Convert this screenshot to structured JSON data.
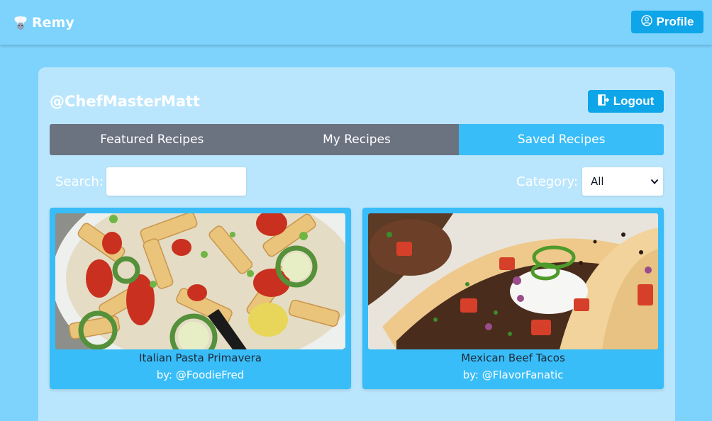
{
  "navbar": {
    "brand": "Remy",
    "brand_icon": "chef-hat-icon",
    "profile_label": "Profile",
    "profile_icon": "user-circle-icon"
  },
  "account": {
    "username": "@ChefMasterMatt",
    "logout_label": "Logout",
    "logout_icon": "logout-icon"
  },
  "tabs": [
    {
      "label": "Featured Recipes",
      "active": false
    },
    {
      "label": "My Recipes",
      "active": false
    },
    {
      "label": "Saved Recipes",
      "active": true
    }
  ],
  "filters": {
    "search_label": "Search:",
    "search_value": "",
    "category_label": "Category:",
    "category_selected": "All"
  },
  "recipes": [
    {
      "title": "Italian Pasta Primavera",
      "author": "by: @FoodieFred"
    },
    {
      "title": "Mexican Beef Tacos",
      "author": "by: @FlavorFanatic"
    }
  ],
  "colors": {
    "page_bg": "#7dd3fc",
    "card_bg": "#bae6fd",
    "accent": "#0ea5e9",
    "tab_inactive": "#6b7280",
    "tab_active": "#38bdf8"
  }
}
